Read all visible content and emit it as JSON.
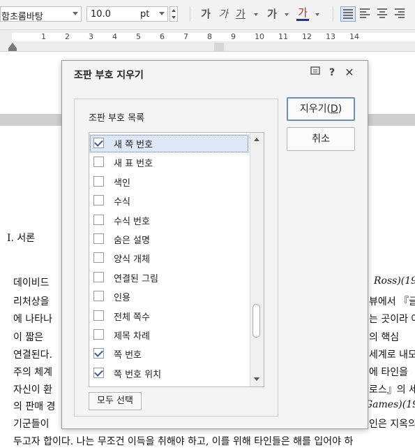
{
  "toolbar": {
    "font_name": "함초롬바탕",
    "font_size": "10.0",
    "font_unit": "pt",
    "style_buttons": [
      "가",
      "가",
      "가",
      "가",
      "가"
    ]
  },
  "ruler": {
    "numbers": [
      "1",
      "2",
      "3",
      "4",
      "5",
      "6",
      "7",
      "8",
      "9",
      "10",
      "11",
      "12",
      "13",
      "14"
    ]
  },
  "document": {
    "heading": "I. 서론",
    "lines": [
      "데이비드",
      "리처상을",
      "에 나타나",
      "이 짧은",
      "연결된다.",
      "주의 체계",
      "자신이 환",
      "의 판매 경",
      "기군들이",
      "두고자 합이다. 나는 무조건 이득을 취해야 하고, 이를 위해 타인들은 해를 입어야 하"
    ],
    "right_fragments": [
      "Ross)(19",
      "뷰에서 『글",
      "는 곳이라 여",
      "의 핵심",
      "세계로 내모",
      "에 타인을",
      "로스』의 세",
      "Games)(19",
      "인은 지옥의"
    ]
  },
  "dialog": {
    "title": "조판 부호 지우기",
    "group_label": "조판 부호 목록",
    "items": [
      {
        "label": "새 쪽 번호",
        "checked": true,
        "selected": true
      },
      {
        "label": "새 표 번호",
        "checked": false
      },
      {
        "label": "색인",
        "checked": false
      },
      {
        "label": "수식",
        "checked": false
      },
      {
        "label": "수식 번호",
        "checked": false
      },
      {
        "label": "숨은 설명",
        "checked": false
      },
      {
        "label": "양식 개체",
        "checked": false
      },
      {
        "label": "연결된 그림",
        "checked": false
      },
      {
        "label": "인용",
        "checked": false
      },
      {
        "label": "전체 쪽수",
        "checked": false
      },
      {
        "label": "제목 차례",
        "checked": false
      },
      {
        "label": "쪽 번호",
        "checked": true
      },
      {
        "label": "쪽 번호 위치",
        "checked": true
      }
    ],
    "select_all_label": "모두 선택",
    "delete_label": "지우기(D)",
    "cancel_label": "취소"
  }
}
